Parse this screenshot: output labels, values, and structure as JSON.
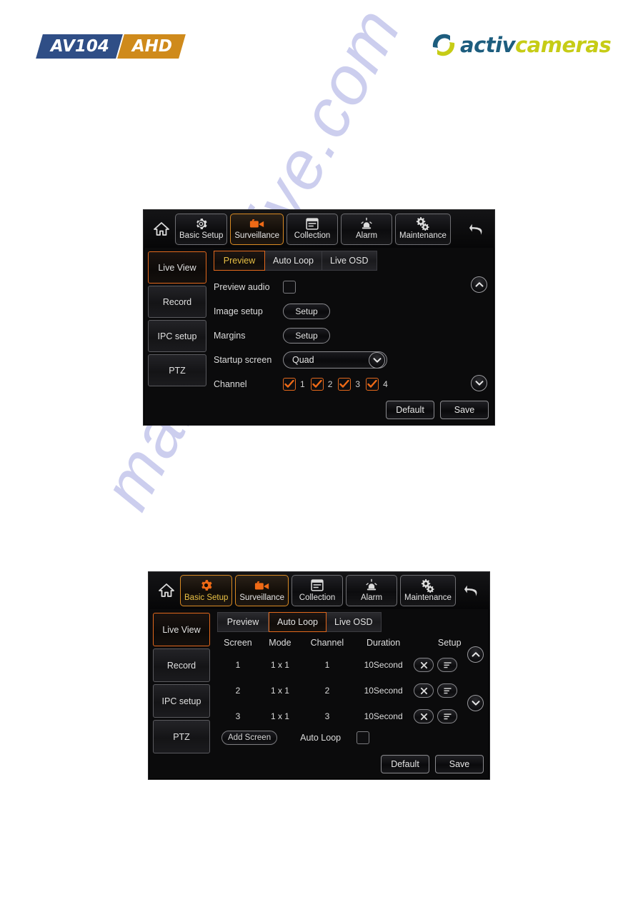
{
  "header": {
    "product_logo": {
      "model": "AV104",
      "tech": "AHD"
    },
    "brand_logo": {
      "part1": "activ",
      "part2": "cameras"
    }
  },
  "watermark": {
    "text": "manualshive.com",
    "color": "#b9bce8"
  },
  "colors": {
    "accent_orange": "#e2681c",
    "accent_gold": "#e8c044",
    "panel_bg": "#0b0b0c",
    "brand_blue": "#1d5d7e",
    "brand_yellow": "#c6cc16",
    "logo_blue": "#2f4e86",
    "logo_gold": "#cf8a1b"
  },
  "panel1": {
    "toolbar": {
      "home_icon": "home-icon",
      "back_icon": "back-arrow-icon",
      "items": [
        {
          "label": "Basic Setup",
          "icon": "gear-icon",
          "active": false
        },
        {
          "label": "Surveillance",
          "icon": "camcorder-icon",
          "active": true
        },
        {
          "label": "Collection",
          "icon": "window-list-icon",
          "active": false
        },
        {
          "label": "Alarm",
          "icon": "siren-icon",
          "active": false
        },
        {
          "label": "Maintenance",
          "icon": "gears-icon",
          "active": false
        }
      ]
    },
    "sidebar": [
      {
        "label": "Live View",
        "active": true
      },
      {
        "label": "Record",
        "active": false
      },
      {
        "label": "IPC setup",
        "active": false
      },
      {
        "label": "PTZ",
        "active": false
      }
    ],
    "tabs": [
      {
        "label": "Preview",
        "active": true
      },
      {
        "label": "Auto Loop",
        "active": false
      },
      {
        "label": "Live OSD",
        "active": false
      }
    ],
    "form": {
      "preview_audio_label": "Preview audio",
      "preview_audio_checked": false,
      "image_setup_label": "Image setup",
      "image_setup_button": "Setup",
      "margins_label": "Margins",
      "margins_button": "Setup",
      "startup_screen_label": "Startup screen",
      "startup_screen_value": "Quad",
      "startup_screen_options": [
        "Quad"
      ],
      "channel_label": "Channel",
      "channels": [
        {
          "num": "1",
          "checked": true
        },
        {
          "num": "2",
          "checked": true
        },
        {
          "num": "3",
          "checked": true
        },
        {
          "num": "4",
          "checked": true
        }
      ]
    },
    "scroll_up_icon": "chevron-up-icon",
    "scroll_down_icon": "chevron-down-icon",
    "footer": {
      "default_label": "Default",
      "save_label": "Save"
    }
  },
  "panel2": {
    "toolbar": {
      "home_icon": "home-icon",
      "back_icon": "back-arrow-icon",
      "items": [
        {
          "label": "Basic Setup",
          "icon": "gear-icon",
          "active": true
        },
        {
          "label": "Surveillance",
          "icon": "camcorder-icon",
          "active": true
        },
        {
          "label": "Collection",
          "icon": "window-list-icon",
          "active": false
        },
        {
          "label": "Alarm",
          "icon": "siren-icon",
          "active": false
        },
        {
          "label": "Maintenance",
          "icon": "gears-icon",
          "active": false
        }
      ]
    },
    "sidebar": [
      {
        "label": "Live View",
        "active": true
      },
      {
        "label": "Record",
        "active": false
      },
      {
        "label": "IPC setup",
        "active": false
      },
      {
        "label": "PTZ",
        "active": false
      }
    ],
    "tabs": [
      {
        "label": "Preview",
        "active": false
      },
      {
        "label": "Auto Loop",
        "active": true
      },
      {
        "label": "Live OSD",
        "active": false
      }
    ],
    "table": {
      "headers": [
        "Screen",
        "Mode",
        "Channel",
        "Duration",
        "Setup"
      ],
      "rows": [
        {
          "screen": "1",
          "mode": "1 x 1",
          "channel": "1",
          "duration": "10Second"
        },
        {
          "screen": "2",
          "mode": "1 x 1",
          "channel": "2",
          "duration": "10Second"
        },
        {
          "screen": "3",
          "mode": "1 x 1",
          "channel": "3",
          "duration": "10Second"
        }
      ],
      "row_delete_icon": "close-x-icon",
      "row_edit_icon": "list-lines-icon"
    },
    "add_screen_label": "Add Screen",
    "auto_loop_label": "Auto Loop",
    "auto_loop_checked": false,
    "scroll_up_icon": "chevron-up-icon",
    "scroll_down_icon": "chevron-down-icon",
    "footer": {
      "default_label": "Default",
      "save_label": "Save"
    }
  }
}
